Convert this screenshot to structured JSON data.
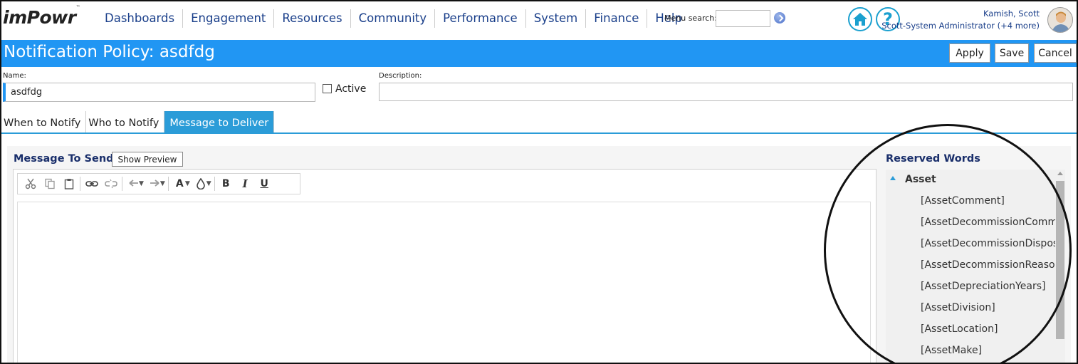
{
  "app": {
    "logo_text": "imPowr",
    "logo_tm": "™"
  },
  "nav": {
    "items": [
      "Dashboards",
      "Engagement",
      "Resources",
      "Community",
      "Performance",
      "System",
      "Finance",
      "Help"
    ],
    "menu_search_label": "Menu search:",
    "menu_search_value": ""
  },
  "user": {
    "name": "Kamish, Scott",
    "role": "Scott-System Administrator (+4 more)"
  },
  "page": {
    "title": "Notification Policy: asdfdg",
    "apply_label": "Apply",
    "save_label": "Save",
    "cancel_label": "Cancel"
  },
  "form": {
    "name_label": "Name:",
    "name_value": "asdfdg",
    "active_label": "Active",
    "active_checked": false,
    "description_label": "Description:",
    "description_value": ""
  },
  "tabs": [
    {
      "label": "When to Notify",
      "active": false
    },
    {
      "label": "Who to Notify",
      "active": false
    },
    {
      "label": "Message to Deliver",
      "active": true
    }
  ],
  "message": {
    "section_title": "Message To Send",
    "preview_label": "Show Preview"
  },
  "toolbar": {
    "tools": [
      "cut-icon",
      "copy-icon",
      "paste-icon",
      "link-icon",
      "unlink-icon",
      "undo-icon",
      "redo-icon",
      "font-color-icon",
      "background-color-icon",
      "bold-icon",
      "italic-icon",
      "underline-icon"
    ],
    "bold_label": "B",
    "italic_label": "I",
    "underline_label": "U",
    "font_label": "A"
  },
  "reserved_words": {
    "title": "Reserved Words",
    "group": "Asset",
    "items": [
      "[AssetComment]",
      "[AssetDecommissionComment]",
      "[AssetDecommissionDisposition]",
      "[AssetDecommissionReason]",
      "[AssetDepreciationYears]",
      "[AssetDivision]",
      "[AssetLocation]",
      "[AssetMake]"
    ]
  },
  "colors": {
    "accent": "#2196f3",
    "tab_active": "#2b9cd8",
    "nav_text": "#1a3f8a"
  }
}
